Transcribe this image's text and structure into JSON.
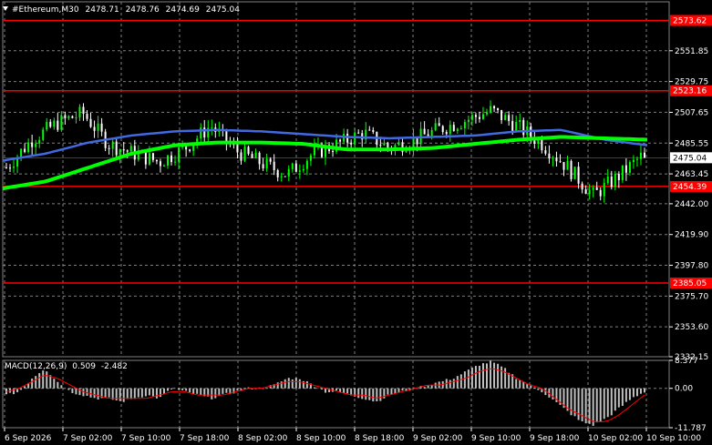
{
  "window": {
    "title": "#Ethereum,M30",
    "ohlc": [
      "2478.71",
      "2478.76",
      "2474.69",
      "2475.04"
    ]
  },
  "colors": {
    "background": "#000000",
    "bull_candle": "#00ff00",
    "bear_candle": "#ffffff",
    "level_line": "#ff0000",
    "ma_slow": "#00ff00",
    "ma_fast": "#4169e1",
    "histogram": "#c0c0c0",
    "signal": "#ff0000"
  },
  "chart_data": [
    {
      "type": "candlestick",
      "symbol": "#Ethereum",
      "timeframe": "M30",
      "ylim": [
        2332.15,
        2587.0
      ],
      "y_ticks": [
        "2551.85",
        "2529.75",
        "2507.65",
        "2485.55",
        "2463.45",
        "2442.00",
        "2419.90",
        "2397.80",
        "2375.70",
        "2353.60",
        "2332.15"
      ],
      "x_ticks": [
        "6 Sep 2026",
        "7 Sep 02:00",
        "7 Sep 10:00",
        "7 Sep 18:00",
        "8 Sep 02:00",
        "8 Sep 10:00",
        "8 Sep 18:00",
        "9 Sep 02:00",
        "9 Sep 10:00",
        "9 Sep 18:00",
        "10 Sep 02:00",
        "10 Sep 10:00"
      ],
      "grid": true,
      "horizontal_levels": [
        {
          "label": "2573.62",
          "value": 2573.62
        },
        {
          "label": "2523.16",
          "value": 2523.16
        },
        {
          "label": "2454.39",
          "value": 2454.39
        },
        {
          "label": "2385.05",
          "value": 2385.05
        }
      ],
      "current_price": {
        "label": "2475.04",
        "value": 2475.04
      },
      "trend_anchors_slow": [
        2453,
        2458,
        2468,
        2478,
        2484,
        2486,
        2486,
        2485,
        2481,
        2481,
        2482,
        2485,
        2488,
        2490,
        2489,
        2488
      ],
      "trend_anchors_fast": [
        2473,
        2478,
        2486,
        2491,
        2494,
        2495,
        2494,
        2492,
        2490,
        2489,
        2490,
        2491,
        2494,
        2495,
        2488,
        2484
      ],
      "close_anchors": [
        2468,
        2488,
        2500,
        2507,
        2485,
        2478,
        2472,
        2482,
        2498,
        2480,
        2471,
        2463,
        2478,
        2485,
        2493,
        2482,
        2488,
        2496,
        2502,
        2509,
        2498,
        2485,
        2468,
        2448,
        2462,
        2478
      ],
      "ohlc_last": {
        "open": 2478.71,
        "high": 2478.76,
        "low": 2474.69,
        "close": 2475.04
      }
    },
    {
      "type": "macd",
      "title": "MACD(12,26,9)",
      "values": [
        "0.509",
        "-2.482"
      ],
      "ylim": [
        -11.787,
        8.377
      ],
      "y_ticks": [
        "8.377",
        "0.00",
        "-11.787"
      ],
      "hist_anchors": [
        -2,
        -1,
        3,
        6,
        2,
        -1,
        -2,
        -3,
        -3,
        -4,
        -3,
        -2,
        -3,
        0,
        -1,
        -2,
        -3,
        -2,
        -1,
        0,
        0,
        1,
        3,
        3,
        1,
        -1,
        -1,
        -2,
        -3,
        -4,
        -2,
        -1,
        0,
        1,
        2,
        3,
        5,
        7,
        8,
        6,
        3,
        1,
        -1,
        -4,
        -7,
        -10,
        -11,
        -9,
        -6,
        -3,
        -1
      ],
      "signal_anchors": [
        -1,
        0,
        2,
        4,
        3,
        1,
        -1,
        -2,
        -3,
        -3,
        -3,
        -3,
        -2,
        -1,
        -1,
        -2,
        -2,
        -2,
        -1,
        0,
        0,
        1,
        2,
        2,
        1,
        0,
        -1,
        -2,
        -2,
        -3,
        -2,
        -1,
        0,
        1,
        1,
        2,
        3,
        5,
        6,
        5,
        3,
        1,
        0,
        -3,
        -6,
        -8,
        -10,
        -10,
        -8,
        -5,
        -2
      ]
    }
  ]
}
